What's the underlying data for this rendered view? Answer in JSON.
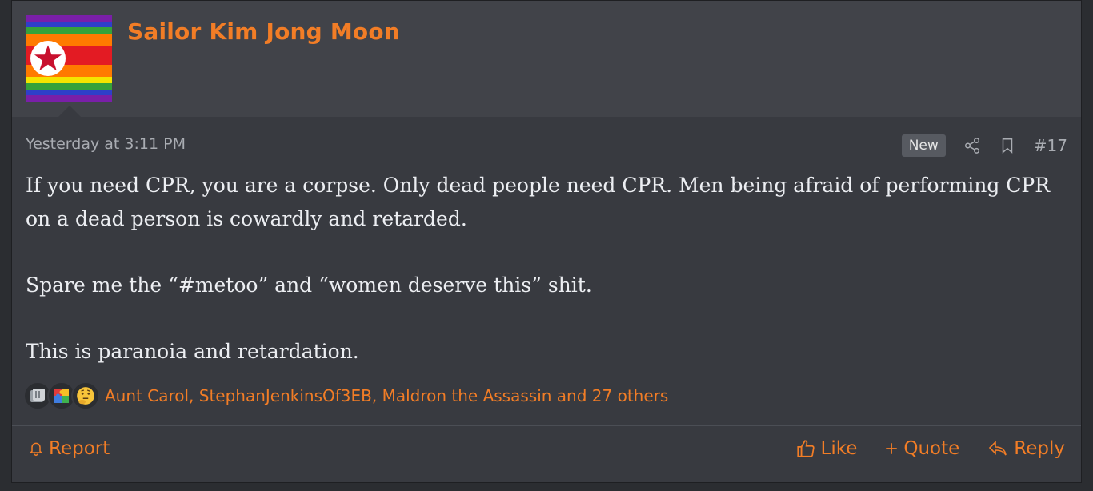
{
  "user": {
    "name": "Sailor Kim Jong Moon",
    "avatar_icon": "rainbow-flag-star-avatar"
  },
  "post": {
    "timestamp": "Yesterday at 3:11 PM",
    "badge": "New",
    "number": "#17",
    "paragraphs": [
      "If you need CPR, you are a corpse. Only dead people need CPR. Men being afraid of performing CPR on a dead person is cowardly and retarded.",
      "Spare me the “#metoo” and “women deserve this” shit.",
      "This is paranoia and retardation."
    ]
  },
  "reactions": {
    "icons": [
      "gallery-icon",
      "puzzle-icon",
      "thinking-face-icon"
    ],
    "summary": "Aunt Carol, StephanJenkinsOf3EB, Maldron the Assassin and 27 others"
  },
  "actions": {
    "report": "Report",
    "like": "Like",
    "quote": "Quote",
    "reply": "Reply"
  },
  "colors": {
    "accent": "#f27d26",
    "background": "#383a40",
    "header": "#414349",
    "text": "#eceef2",
    "muted": "#a9acb2"
  }
}
